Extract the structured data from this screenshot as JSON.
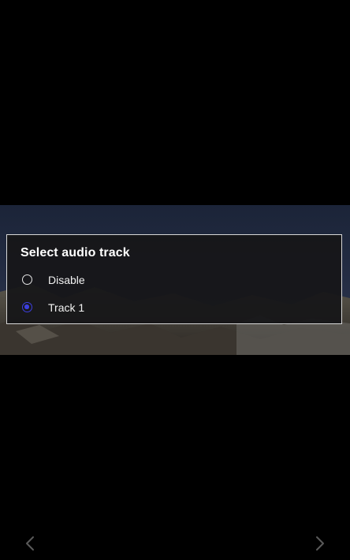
{
  "dialog": {
    "title": "Select audio track",
    "options": [
      {
        "label": "Disable",
        "selected": false
      },
      {
        "label": "Track 1",
        "selected": true
      }
    ]
  },
  "navigation": {
    "prev_icon": "chevron-left-icon",
    "next_icon": "chevron-right-icon"
  },
  "colors": {
    "background": "#000000",
    "dialog_background": "#161618",
    "dialog_border": "#d8d8d8",
    "radio_selected": "#3c3fe0",
    "text": "#ffffff",
    "nav_arrow": "#5a5a5a"
  }
}
